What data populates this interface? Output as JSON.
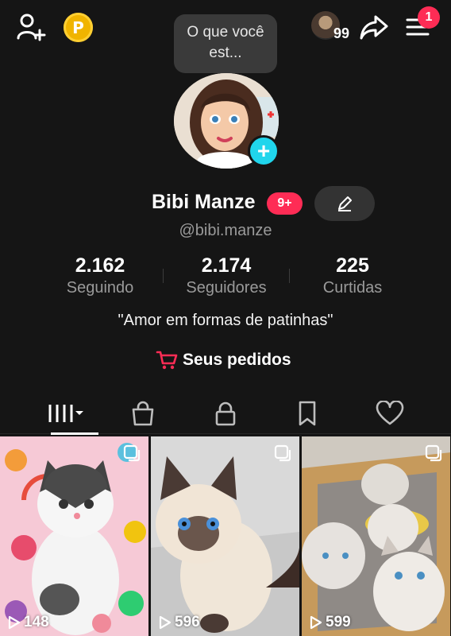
{
  "header": {
    "coin_letter": "P",
    "friends_count": "99",
    "notifications_count": "1",
    "status_bubble": "O que você est..."
  },
  "profile": {
    "name": "Bibi Manze",
    "name_badge": "9+",
    "handle": "@bibi.manze",
    "bio": "\"Amor em formas de patinhas\"",
    "orders_label": "Seus pedidos"
  },
  "stats": [
    {
      "value": "2.162",
      "label": "Seguindo"
    },
    {
      "value": "2.174",
      "label": "Seguidores"
    },
    {
      "value": "225",
      "label": "Curtidas"
    }
  ],
  "tabs": [
    "videos-grid-icon",
    "shop-bag-icon",
    "lock-icon",
    "bookmark-icon",
    "heart-icon"
  ],
  "videos": [
    {
      "views": "148"
    },
    {
      "views": "596"
    },
    {
      "views": "599"
    }
  ],
  "colors": {
    "background": "#151515",
    "accent_pink": "#fe2c55",
    "accent_cyan": "#20d5ec",
    "coin": "#f0b400"
  }
}
